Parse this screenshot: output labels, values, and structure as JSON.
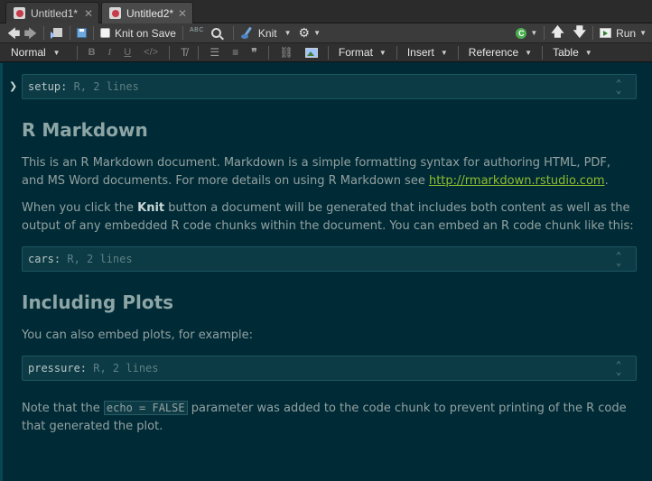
{
  "tabs": [
    {
      "label": "Untitled1*",
      "active": false
    },
    {
      "label": "Untitled2*",
      "active": true
    }
  ],
  "toolbar": {
    "knit_on_save": "Knit on Save",
    "abc": "ABC",
    "knit": "Knit",
    "run": "Run"
  },
  "formatbar": {
    "style": "Normal",
    "bold": "B",
    "italic": "I",
    "underline": "U",
    "code": "</>",
    "format": "Format",
    "insert": "Insert",
    "reference": "Reference",
    "table": "Table"
  },
  "document": {
    "chunk_setup": {
      "name": "setup:",
      "meta": " R, 2 lines"
    },
    "heading1": "R Markdown",
    "p1_text": "This is an R Markdown document. Markdown is a simple formatting syntax for authoring HTML, PDF, and MS Word documents. For more details on using R Markdown see ",
    "p1_link": "http://rmarkdown.rstudio.com",
    "p1_end": ".",
    "p2_a": "When you click the ",
    "p2_bold": "Knit",
    "p2_b": " button a document will be generated that includes both content as well as the output of any embedded R code chunks within the document. You can embed an R code chunk like this:",
    "chunk_cars": {
      "name": "cars:",
      "meta": " R, 2 lines"
    },
    "heading2": "Including Plots",
    "p3": "You can also embed plots, for example:",
    "chunk_pressure": {
      "name": "pressure:",
      "meta": " R, 2 lines"
    },
    "p4_a": "Note that the ",
    "p4_code": "echo = FALSE",
    "p4_b": " parameter was added to the code chunk to prevent printing of the R code that generated the plot."
  },
  "colors": {
    "background": "#002b36",
    "chunk_background": "#0c3b45",
    "heading": "#8ea5a6",
    "text": "#93a1a1",
    "link": "#8fbc2e"
  }
}
